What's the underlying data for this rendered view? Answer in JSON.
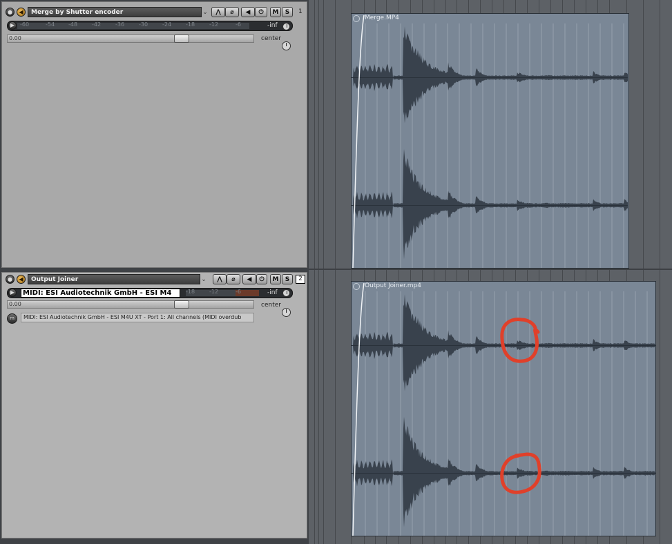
{
  "tracks": [
    {
      "name": "Merge by Shutter encoder",
      "number": "1",
      "meter_ticks": [
        "-60",
        "-54",
        "-48",
        "-42",
        "-36",
        "-30",
        "-24",
        "-18",
        "-12",
        "-6"
      ],
      "meter_db": "-inf",
      "volume": "0.00",
      "pan": "center",
      "buttons": {
        "mute": "M",
        "solo": "S"
      }
    },
    {
      "name": "Output Joiner",
      "number": "2",
      "input": "MIDI: ESI Audiotechnik GmbH - ESI M4",
      "meter_ticks": [
        "-18",
        "-12",
        "-6"
      ],
      "meter_db": "-inf",
      "volume": "0.00",
      "pan": "center",
      "buttons": {
        "mute": "M",
        "solo": "S"
      },
      "midi_input": "MIDI: ESI Audiotechnik GmbH - ESI M4U XT - Port 1: All channels (MIDI overdub"
    }
  ],
  "items": [
    {
      "name": "Merge.MP4"
    },
    {
      "name": "Output Joiner.mp4"
    }
  ],
  "annotations": {
    "color": "#e0402a"
  },
  "colors": {
    "item_bg": "#7a8796",
    "waveform": "#39424d",
    "tcp_bg": "#a9a9a9"
  }
}
